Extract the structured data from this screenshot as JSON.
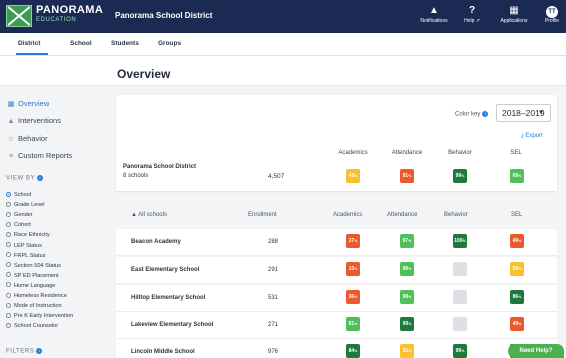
{
  "brand": {
    "name": "PANORAMA",
    "sub": "EDUCATION"
  },
  "district_name": "Panorama School District",
  "top_actions": [
    {
      "label": "Notifications",
      "icon": "bell-icon",
      "glyph": "🔔"
    },
    {
      "label": "Help ↗",
      "icon": "help-icon",
      "glyph": "?"
    },
    {
      "label": "Applications",
      "icon": "grid-icon",
      "glyph": "⁙"
    },
    {
      "label": "Profile",
      "icon": "avatar",
      "glyph": "TT"
    }
  ],
  "subnav": [
    "District",
    "School",
    "Students",
    "Groups"
  ],
  "page_title": "Overview",
  "sidebar": {
    "links": [
      {
        "label": "Overview",
        "icon": "grid-icon",
        "glyph": "▦",
        "active": true
      },
      {
        "label": "Interventions",
        "icon": "warning-icon",
        "glyph": "▲",
        "active": false
      },
      {
        "label": "Behavior",
        "icon": "star-icon",
        "glyph": "☆",
        "active": false
      },
      {
        "label": "Custom Reports",
        "icon": "sliders-icon",
        "glyph": "≡",
        "active": false
      }
    ],
    "view_by_label": "VIEW BY",
    "view_by_options": [
      {
        "label": "School",
        "selected": true
      },
      {
        "label": "Grade Level",
        "selected": false
      },
      {
        "label": "Gender",
        "selected": false
      },
      {
        "label": "Cohort",
        "selected": false
      },
      {
        "label": "Race Ethnicity",
        "selected": false
      },
      {
        "label": "LEP Status",
        "selected": false
      },
      {
        "label": "FRPL Status",
        "selected": false
      },
      {
        "label": "Section 504 Status",
        "selected": false
      },
      {
        "label": "SP ED Placement",
        "selected": false
      },
      {
        "label": "Home Language",
        "selected": false
      },
      {
        "label": "Homeless Residence",
        "selected": false
      },
      {
        "label": "Mode of Instruction",
        "selected": false
      },
      {
        "label": "Pre K Early Intervention",
        "selected": false
      },
      {
        "label": "School Counselor",
        "selected": false
      }
    ],
    "filters_label": "FILTERS"
  },
  "summary": {
    "color_key_label": "Color key",
    "year": "2018–2019",
    "export_label": "⤓ Export",
    "columns": [
      "Academics",
      "Attendance",
      "Behavior",
      "SEL"
    ],
    "district_label": "Panorama School District",
    "district_sub": "8 schools",
    "enrollment": "4,507",
    "chips": [
      {
        "value": "48",
        "unit": "%",
        "color": "#f9c12e"
      },
      {
        "value": "91",
        "unit": "%",
        "color": "#ea5a2a"
      },
      {
        "value": "99",
        "unit": "%",
        "color": "#1e7a3c"
      },
      {
        "value": "69",
        "unit": "%",
        "color": "#4fbf5a"
      }
    ]
  },
  "table": {
    "sort_label": "▲ All schools",
    "headers": [
      "Enrollment",
      "Academics",
      "Attendance",
      "Behavior",
      "SEL"
    ],
    "rows": [
      {
        "name": "Beacon Academy",
        "enrollment": "288",
        "chips": [
          {
            "value": "37",
            "unit": "%",
            "color": "#ea5a2a"
          },
          {
            "value": "97",
            "unit": "%",
            "color": "#4fbf5a"
          },
          {
            "value": "100",
            "unit": "%",
            "color": "#1e7a3c"
          },
          {
            "value": "49",
            "unit": "%",
            "color": "#ea5a2a"
          }
        ]
      },
      {
        "name": "East Elementary School",
        "enrollment": "291",
        "chips": [
          {
            "value": "10",
            "unit": "%",
            "color": "#ea5a2a"
          },
          {
            "value": "96",
            "unit": "%",
            "color": "#4fbf5a"
          },
          {
            "value": "",
            "unit": "",
            "color": "#dcdfe3"
          },
          {
            "value": "50",
            "unit": "%",
            "color": "#f9c12e"
          }
        ]
      },
      {
        "name": "Hilltop Elementary School",
        "enrollment": "531",
        "chips": [
          {
            "value": "36",
            "unit": "%",
            "color": "#ea5a2a"
          },
          {
            "value": "98",
            "unit": "%",
            "color": "#4fbf5a"
          },
          {
            "value": "",
            "unit": "",
            "color": "#dcdfe3"
          },
          {
            "value": "86",
            "unit": "%",
            "color": "#1e7a3c"
          }
        ]
      },
      {
        "name": "Lakeview Elementary School",
        "enrollment": "271",
        "chips": [
          {
            "value": "61",
            "unit": "%",
            "color": "#4fbf5a"
          },
          {
            "value": "99",
            "unit": "%",
            "color": "#1e7a3c"
          },
          {
            "value": "",
            "unit": "",
            "color": "#dcdfe3"
          },
          {
            "value": "49",
            "unit": "%",
            "color": "#ea5a2a"
          }
        ]
      },
      {
        "name": "Lincoln Middle School",
        "enrollment": "976",
        "chips": [
          {
            "value": "84",
            "unit": "%",
            "color": "#1e7a3c"
          },
          {
            "value": "91",
            "unit": "%",
            "color": "#f9c12e"
          },
          {
            "value": "99",
            "unit": "%",
            "color": "#1e7a3c"
          },
          {
            "value": "85",
            "unit": "%",
            "color": "#1e7a3c"
          }
        ]
      }
    ]
  },
  "help_button": "Need Help?"
}
